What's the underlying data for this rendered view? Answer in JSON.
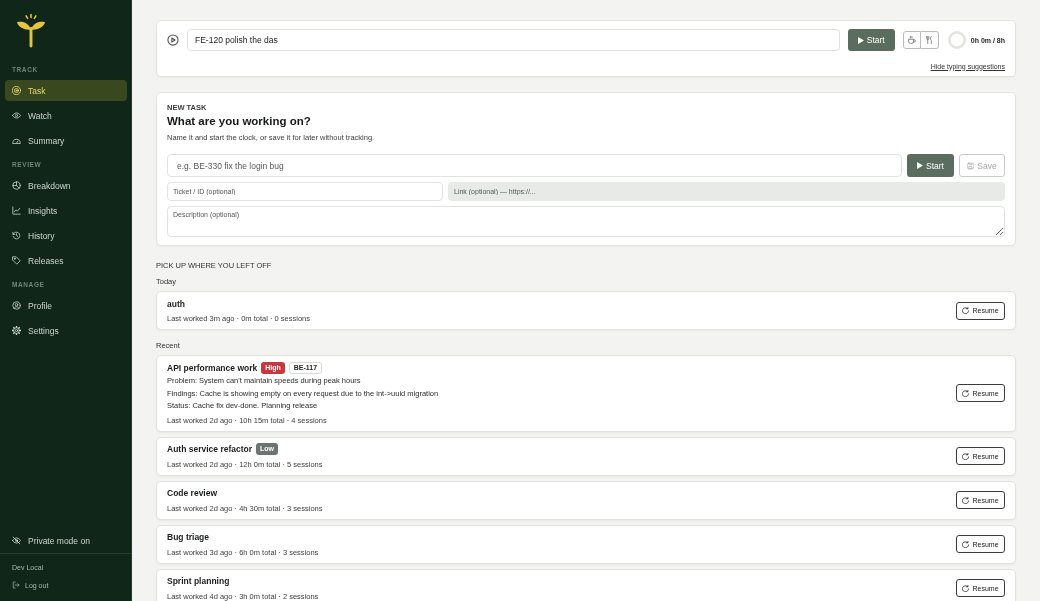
{
  "sidebar": {
    "sections": [
      {
        "label": "TRACK",
        "items": [
          {
            "label": "Task",
            "selected": true
          },
          {
            "label": "Watch",
            "selected": false
          },
          {
            "label": "Summary",
            "selected": false
          }
        ]
      },
      {
        "label": "REVIEW",
        "items": [
          {
            "label": "Breakdown",
            "selected": false
          },
          {
            "label": "Insights",
            "selected": false
          },
          {
            "label": "History",
            "selected": false
          },
          {
            "label": "Releases",
            "selected": false
          }
        ]
      },
      {
        "label": "MANAGE",
        "items": [
          {
            "label": "Profile",
            "selected": false
          },
          {
            "label": "Settings",
            "selected": false
          }
        ]
      }
    ],
    "private_mode": {
      "label": "Private mode on"
    },
    "user": {
      "name": "Dev Local"
    },
    "logout": {
      "label": "Log out"
    }
  },
  "tracker": {
    "input": {
      "value": "FE-120 polish the das"
    },
    "start_button": {
      "label": "Start"
    },
    "goal": {
      "reading": "0h 0m / 8h"
    },
    "suggestions_link": {
      "label": "Hide typing suggestions"
    }
  },
  "new_task": {
    "eyebrow": "NEW TASK",
    "title": "What are you working on?",
    "subtitle": "Name it and start the clock, or save it for later without tracking.",
    "name_field": {
      "placeholder": "e.g. BE-330 fix the login bug"
    },
    "buttons": [
      {
        "kind": "start",
        "label": "Start",
        "disabled": false
      },
      {
        "kind": "save",
        "label": "Save",
        "disabled": true
      }
    ],
    "fields": [
      {
        "placeholder": "Ticket / ID (optional)",
        "disabled": false
      },
      {
        "placeholder": "Link (optional) — https://...",
        "disabled": true
      }
    ],
    "description": {
      "placeholder": "Description (optional)"
    }
  },
  "pickup": {
    "title": "PICK UP WHERE YOU LEFT OFF",
    "groups": [
      {
        "label": "Today",
        "tasks": [
          {
            "title": "auth",
            "meta": "Last worked 3m ago · 0m total · 0 sessions",
            "action": "Resume"
          }
        ]
      },
      {
        "label": "Recent",
        "tasks": [
          {
            "title": "API performance work",
            "tags": [
              {
                "kind": "priority",
                "label": "High",
                "color": "#c9363e"
              },
              {
                "kind": "ticket",
                "label": "BE-117"
              }
            ],
            "details": [
              "Problem: System can't maintain speeds during peak hours",
              "Findings: Cache is showing empty on every request due to the int->uuid migration",
              "Status: Cache fix dev-done. Planning release"
            ],
            "meta": "Last worked 2d ago · 10h 15m total · 4 sessions",
            "action": "Resume"
          },
          {
            "title": "Auth service refactor",
            "tags": [
              {
                "kind": "priority",
                "label": "Low",
                "color": "#6b7470"
              }
            ],
            "meta": "Last worked 2d ago · 12h 0m total · 5 sessions",
            "action": "Resume"
          },
          {
            "title": "Code review",
            "meta": "Last worked 2d ago · 4h 30m total · 3 sessions",
            "action": "Resume"
          },
          {
            "title": "Bug triage",
            "meta": "Last worked 3d ago · 6h 0m total · 3 sessions",
            "action": "Resume"
          },
          {
            "title": "Sprint planning",
            "meta": "Last worked 4d ago · 3h 0m total · 2 sessions",
            "action": "Resume"
          }
        ]
      }
    ]
  }
}
